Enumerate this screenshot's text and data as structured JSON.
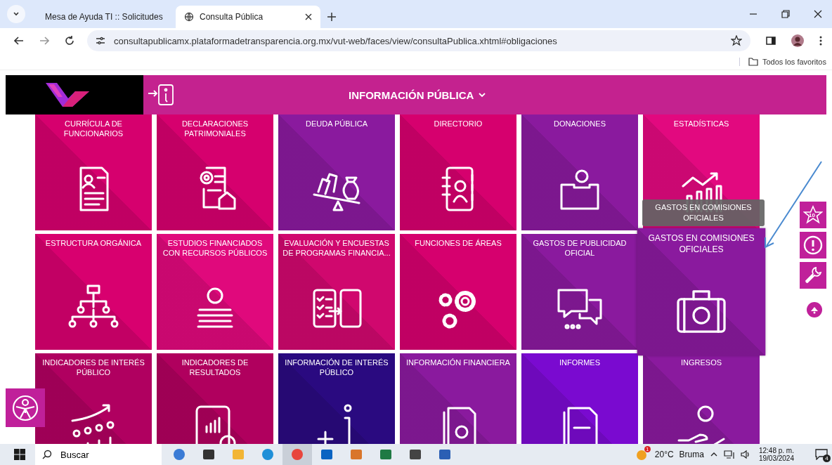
{
  "browser": {
    "tabs": [
      {
        "title": "Mesa de Ayuda TI :: Solicitudes",
        "selected": false
      },
      {
        "title": "Consulta Pública",
        "selected": true
      }
    ],
    "url": "consultapublicamx.plataformadetransparencia.org.mx/vut-web/faces/view/consultaPublica.xhtml#obligaciones",
    "bookmarks": "Todos los favoritos"
  },
  "header": {
    "title": "INFORMACIÓN PÚBLICA"
  },
  "tiles": [
    {
      "title": "CURRÍCULA DE FUNCIONARIOS",
      "color": "#d6006e",
      "highlighted": false
    },
    {
      "title": "DECLARACIONES PATRIMONIALES",
      "color": "#d6006e",
      "highlighted": false
    },
    {
      "title": "DEUDA PÚBLICA",
      "color": "#8a1a9e",
      "highlighted": false
    },
    {
      "title": "DIRECTORIO",
      "color": "#d6006e",
      "highlighted": false
    },
    {
      "title": "DONACIONES",
      "color": "#8a1a9e",
      "highlighted": false
    },
    {
      "title": "ESTADÍSTICAS",
      "color": "#e2097f",
      "highlighted": false
    },
    {
      "title": "ESTRUCTURA ORGÁNICA",
      "color": "#d8006f",
      "highlighted": false
    },
    {
      "title": "ESTUDIOS FINANCIADOS CON RECURSOS PÚBLICOS",
      "color": "#e0097c",
      "highlighted": false
    },
    {
      "title": "EVALUACIÓN Y ENCUESTAS DE PROGRAMAS FINANCIA...",
      "color": "#d0086e",
      "highlighted": false
    },
    {
      "title": "FUNCIONES DE ÁREAS",
      "color": "#d6006e",
      "highlighted": false
    },
    {
      "title": "GASTOS DE PUBLICIDAD OFICIAL",
      "color": "#8a1a9e",
      "highlighted": false
    },
    {
      "title": "GASTOS EN COMISIONES OFICIALES",
      "color": "#8a1a9e",
      "highlighted": true
    },
    {
      "title": "INDICADORES DE INTERÉS PÚBLICO",
      "color": "#b00060",
      "highlighted": false
    },
    {
      "title": "INDICADORES DE RESULTADOS",
      "color": "#b0005e",
      "highlighted": false
    },
    {
      "title": "INFORMACIÓN DE INTERÉS PÚBLICO",
      "color": "#2a0a80",
      "highlighted": false
    },
    {
      "title": "INFORMACIÓN FINANCIERA",
      "color": "#8a1a9e",
      "highlighted": false
    },
    {
      "title": "INFORMES",
      "color": "#7a0ad0",
      "highlighted": false
    },
    {
      "title": "INGRESOS",
      "color": "#8a1a9e",
      "highlighted": false
    }
  ],
  "tooltip": "GASTOS EN COMISIONES OFICIALES",
  "side_buttons": {
    "badge": "10"
  },
  "taskbar": {
    "search": "Buscar",
    "apps": [
      {
        "selected": false
      },
      {
        "selected": false
      },
      {
        "selected": false
      },
      {
        "selected": false
      },
      {
        "selected": true
      },
      {
        "selected": false
      },
      {
        "selected": false
      },
      {
        "selected": false
      },
      {
        "selected": false
      },
      {
        "selected": false
      }
    ],
    "weather_badge": "1",
    "temperature": "20°C",
    "weather": "Bruma",
    "time": "12:48 p. m.",
    "date": "19/03/2024",
    "notifications": "4"
  }
}
